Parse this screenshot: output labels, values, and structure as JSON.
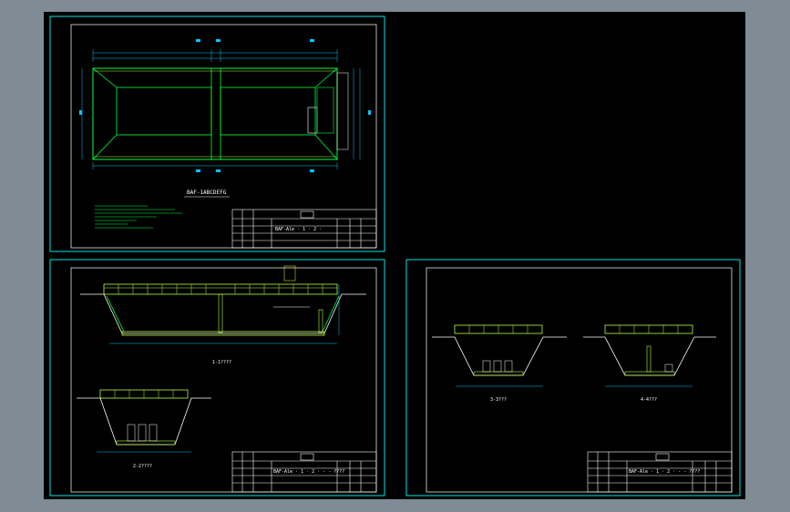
{
  "colors": {
    "background": "#7f8b95",
    "model_space": "#000000",
    "sheet_border": "#00e5e5",
    "structure": "#00ff3c",
    "railing": "#b6ff3c",
    "dimension": "#00c8ff",
    "text": "#ffffff",
    "annotation": "#ffff00"
  },
  "sheets": [
    {
      "drawing_title": "BAF-1ABCDEFG",
      "title_block": {
        "project_text": "BAF-Ale · 1 · 2 ·"
      }
    },
    {
      "section_label_1": "1-1????",
      "section_label_2": "2-2????",
      "title_block": {
        "project_text": "BAF-Ale · 1 · 2 · - - ????"
      }
    },
    {
      "section_label_1": "3-3???",
      "section_label_2": "4-4???",
      "title_block": {
        "project_text": "BAF-Ale · 1 · 2 · - - ????"
      }
    }
  ]
}
